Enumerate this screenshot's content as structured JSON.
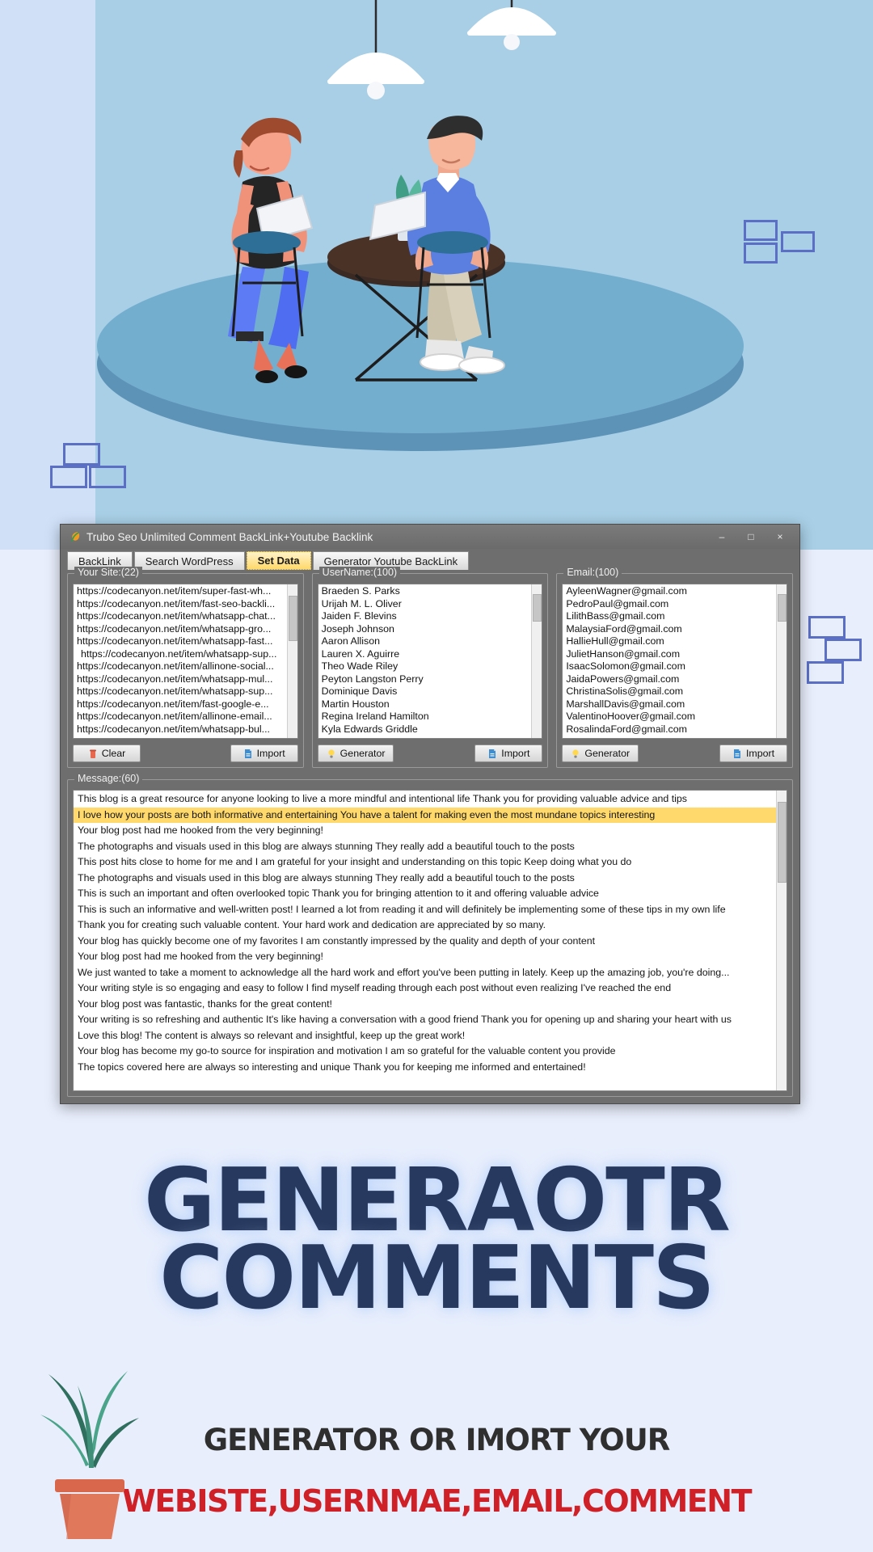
{
  "window": {
    "title": "Trubo Seo Unlimited Comment BackLink+Youtube Backlink",
    "app_icon": "leaf-icon",
    "controls": {
      "minimize": "–",
      "maximize": "□",
      "close": "×"
    },
    "tabs": [
      {
        "label": "BackLink",
        "active": false
      },
      {
        "label": "Search WordPress",
        "active": false
      },
      {
        "label": "Set Data",
        "active": true
      },
      {
        "label": "Generator Youtube BackLink",
        "active": false
      }
    ]
  },
  "panels": {
    "site": {
      "title": "Your Site:(22)",
      "items": [
        "https://codecanyon.net/item/super-fast-wh...",
        "https://codecanyon.net/item/fast-seo-backli...",
        "https://codecanyon.net/item/whatsapp-chat...",
        "https://codecanyon.net/item/whatsapp-gro...",
        "https://codecanyon.net/item/whatsapp-fast...",
        "https://codecanyon.net/item/whatsapp-sup...",
        "https://codecanyon.net/item/allinone-social...",
        "https://codecanyon.net/item/whatsapp-mul...",
        "https://codecanyon.net/item/whatsapp-sup...",
        "https://codecanyon.net/item/fast-google-e...",
        "https://codecanyon.net/item/allinone-email...",
        "https://codecanyon.net/item/whatsapp-bul..."
      ],
      "buttons": {
        "left": {
          "label": "Clear",
          "icon": "trash-icon"
        },
        "right": {
          "label": "Import",
          "icon": "import-file-icon"
        }
      }
    },
    "username": {
      "title": "UserName:(100)",
      "items": [
        "Braeden S. Parks",
        "Urijah M. L. Oliver",
        "Jaiden F. Blevins",
        "Joseph Johnson",
        "Aaron Allison",
        "Lauren X. Aguirre",
        "Theo Wade Riley",
        "Peyton Langston Perry",
        "Dominique Davis",
        "Martin Houston",
        "Regina Ireland Hamilton",
        "Kyla Edwards Griddle"
      ],
      "buttons": {
        "left": {
          "label": "Generator",
          "icon": "lightbulb-icon"
        },
        "right": {
          "label": "Import",
          "icon": "import-file-icon"
        }
      }
    },
    "email": {
      "title": "Email:(100)",
      "items": [
        "AyleenWagner@gmail.com",
        "PedroPaul@gmail.com",
        "LilithBass@gmail.com",
        "MalaysiaFord@gmail.com",
        "HallieHull@gmail.com",
        "JulietHanson@gmail.com",
        "IsaacSolomon@gmail.com",
        "JaidaPowers@gmail.com",
        "ChristinaSolis@gmail.com",
        "MarshallDavis@gmail.com",
        "ValentinoHoover@gmail.com",
        "RosalindaFord@gmail.com"
      ],
      "buttons": {
        "left": {
          "label": "Generator",
          "icon": "lightbulb-icon"
        },
        "right": {
          "label": "Import",
          "icon": "import-file-icon"
        }
      }
    }
  },
  "message": {
    "title": "Message:(60)",
    "selected_index": 1,
    "items": [
      "This blog is a great resource for anyone looking to live a more mindful and intentional life Thank you for providing valuable advice and tips",
      "I love how your posts are both informative and entertaining You have a talent for making even the most mundane topics interesting",
      "Your blog post had me hooked from the very beginning!",
      "The photographs and visuals used in this blog are always stunning They really add a beautiful touch to the posts",
      "This post hits close to home for me and I am grateful for your insight and understanding on this topic Keep doing what you do",
      "The photographs and visuals used in this blog are always stunning They really add a beautiful touch to the posts",
      "This is such an important and often overlooked topic Thank you for bringing attention to it and offering valuable advice",
      "This is such an informative and well-written post! I learned a lot from reading it and will definitely be implementing some of these tips in my own life",
      "Thank you for creating such valuable content. Your hard work and dedication are appreciated by so many.",
      "Your blog has quickly become one of my favorites I am constantly impressed by the quality and depth of your content",
      "Your blog post had me hooked from the very beginning!",
      "We just wanted to take a moment to acknowledge all the hard work and effort you've been putting in lately. Keep up the amazing job, you're doing...",
      "Your writing style is so engaging and easy to follow I find myself reading through each post without even realizing I've reached the end",
      "Your blog post was fantastic, thanks for the great content!",
      "Your writing is so refreshing and authentic It's like having a conversation with a good friend Thank you for opening up and sharing your heart with us",
      "Love this blog! The content is always so relevant and insightful, keep up the great work!",
      "Your blog has become my go-to source for inspiration and motivation I am so grateful for the valuable content you provide",
      "The topics covered here are always so interesting and unique Thank you for keeping me informed and entertained!"
    ]
  },
  "promo": {
    "headline_line1": "GENERAOTR",
    "headline_line2": "COMMENTS",
    "subtitle_1": "GENERATOR OR IMORT YOUR",
    "subtitle_2": "WEBISTE,USERNMAE,EMAIL,COMMENT"
  },
  "colors": {
    "hero_bg": "#a8cfe6",
    "page_bg": "#e8eefc",
    "headline": "#27395f",
    "subtitle_accent": "#cf2027",
    "tab_active": "#ffd96b",
    "selection": "#ffd96b"
  }
}
